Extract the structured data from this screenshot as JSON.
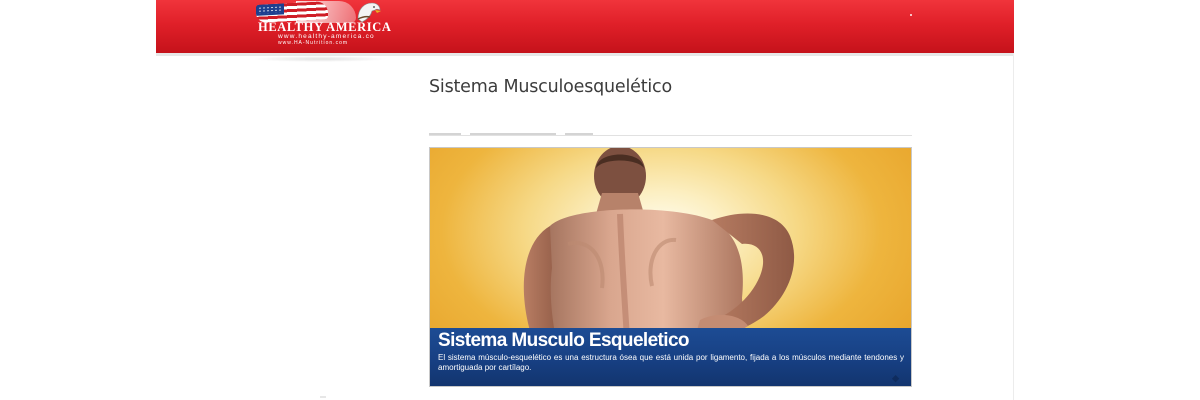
{
  "header": {
    "logo": {
      "brand": "HEALTHY AMERICA",
      "url_primary": "www.healthy-america.co",
      "url_secondary": "www.HA-Nutrition.com"
    },
    "colors": {
      "header_red": "#e02029",
      "banner_blue": "#173f82",
      "banner_orange": "#eeb53e"
    }
  },
  "main": {
    "title": "Sistema Musculoesquelético",
    "banner": {
      "image_icon": "man-back-pain-image",
      "heading": "Sistema Musculo Esqueletico",
      "description": "El sistema músculo-esquelético es una estructura ósea que está unida por ligamento, fijada a los músculos mediante tendones y amortiguada por cartílago."
    }
  }
}
